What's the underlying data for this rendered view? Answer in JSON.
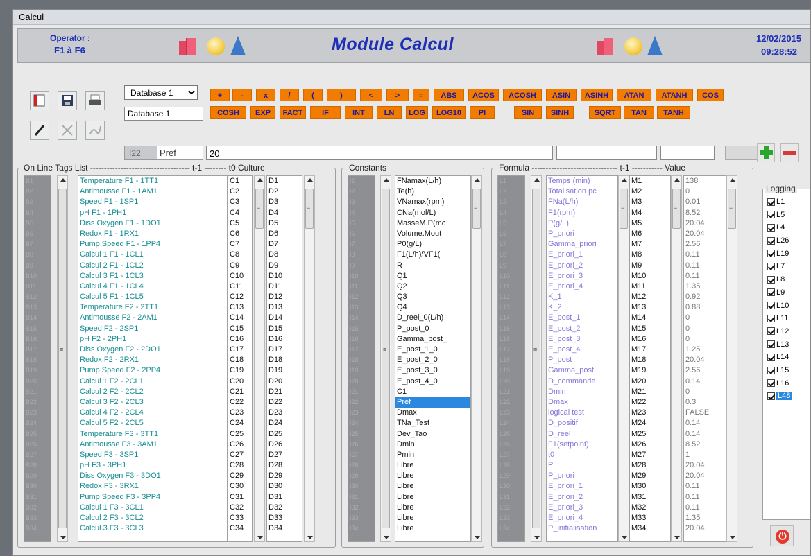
{
  "window": {
    "title": "Calcul"
  },
  "header": {
    "operator_label": "Operator :",
    "operator_value": "F1 à F6",
    "title": "Module Calcul",
    "date": "12/02/2015",
    "time": "09:28:52"
  },
  "toolbar": {
    "icons": [
      "folder-icon",
      "save-icon",
      "printer-icon",
      "pencil-icon",
      "cut-icon",
      "signature-icon"
    ],
    "db_select": "Database 1",
    "db_name": "Database 1",
    "cell_ref": "I22",
    "cell_name": "Pref",
    "formula_value": "20",
    "op_row1": [
      "+",
      "-",
      "x",
      "/",
      "(",
      ")",
      "<",
      ">",
      "=",
      "ABS",
      "ACOS",
      "ACOSH",
      "ASIN",
      "ASINH",
      "ATAN",
      "ATANH",
      "COS"
    ],
    "op_row2": [
      "COSH",
      "EXP",
      "FACT",
      "IF",
      "INT",
      "LN",
      "LOG",
      "LOG10",
      "PI",
      "SIN",
      "SINH",
      "SQRT",
      "TAN",
      "TANH"
    ]
  },
  "tags_group": {
    "label": "On Line Tags List ------------------------------------ t-1 -------- t0 Culture"
  },
  "constants_group": {
    "label": "Constants"
  },
  "formula_group": {
    "label": "Formula ------------------------------- t-1 ----------- Value"
  },
  "row_ids_b": [
    "B1",
    "B2",
    "B3",
    "B4",
    "B5",
    "B6",
    "B7",
    "B8",
    "B9",
    "B10",
    "B11",
    "B12",
    "B13",
    "B14",
    "B15",
    "B16",
    "B17",
    "B18",
    "B19",
    "B20",
    "B21",
    "B22",
    "B23",
    "B24",
    "B25",
    "B26",
    "B27",
    "B28",
    "B29",
    "B30",
    "B31",
    "B32",
    "B33",
    "B34"
  ],
  "row_ids_i": [
    "I1",
    "I2",
    "I3",
    "I4",
    "I5",
    "I6",
    "I7",
    "I8",
    "I9",
    "I10",
    "I11",
    "I12",
    "I13",
    "I14",
    "I15",
    "I16",
    "I17",
    "I18",
    "I19",
    "I20",
    "I21",
    "I22",
    "I23",
    "I24",
    "I25",
    "I26",
    "I27",
    "I28",
    "I29",
    "I30",
    "I31",
    "I32",
    "I33",
    "I34"
  ],
  "row_ids_l": [
    "L1",
    "L2",
    "L3",
    "L4",
    "L5",
    "L6",
    "L7",
    "L8",
    "L9",
    "L10",
    "L11",
    "L12",
    "L13",
    "L14",
    "L15",
    "L16",
    "L17",
    "L18",
    "L19",
    "L20",
    "L21",
    "L22",
    "L23",
    "L24",
    "L25",
    "L26",
    "L27",
    "L28",
    "L29",
    "L30",
    "L31",
    "L32",
    "L33",
    "L34"
  ],
  "tags": [
    "Temperature F1 - 1TT1",
    "Antimousse F1 - 1AM1",
    "Speed F1 - 1SP1",
    "pH F1 - 1PH1",
    "Diss Oxygen F1 - 1DO1",
    "Redox F1 - 1RX1",
    "Pump Speed F1 - 1PP4",
    "Calcul 1 F1 - 1CL1",
    "Calcul 2 F1 - 1CL2",
    "Calcul 3 F1 - 1CL3",
    "Calcul 4 F1 - 1CL4",
    "Calcul 5 F1 - 1CL5",
    "Temperature F2 - 2TT1",
    "Antimousse F2 - 2AM1",
    "Speed F2 - 2SP1",
    "pH F2 - 2PH1",
    "Diss Oxygen F2 - 2DO1",
    "Redox F2 - 2RX1",
    "Pump Speed F2 - 2PP4",
    "Calcul 1 F2 - 2CL1",
    "Calcul 2 F2 - 2CL2",
    "Calcul 3 F2 - 2CL3",
    "Calcul 4 F2 - 2CL4",
    "Calcul 5 F2 - 2CL5",
    "Temperature F3 - 3TT1",
    "Antimousse F3 - 3AM1",
    "Speed F3 - 3SP1",
    "pH F3 - 3PH1",
    "Diss Oxygen F3 - 3DO1",
    "Redox F3 - 3RX1",
    "Pump Speed F3 - 3PP4",
    "Calcul 1 F3 - 3CL1",
    "Calcul 2 F3 - 3CL2",
    "Calcul 3 F3 - 3CL3"
  ],
  "c_col": [
    "C1",
    "C2",
    "C3",
    "C4",
    "C5",
    "C6",
    "C7",
    "C8",
    "C9",
    "C10",
    "C11",
    "C12",
    "C13",
    "C14",
    "C15",
    "C16",
    "C17",
    "C18",
    "C19",
    "C20",
    "C21",
    "C22",
    "C23",
    "C24",
    "C25",
    "C26",
    "C27",
    "C28",
    "C29",
    "C30",
    "C31",
    "C32",
    "C33",
    "C34"
  ],
  "d_col": [
    "D1",
    "D2",
    "D3",
    "D4",
    "D5",
    "D6",
    "D7",
    "D8",
    "D9",
    "D10",
    "D11",
    "D12",
    "D13",
    "D14",
    "D15",
    "D16",
    "D17",
    "D18",
    "D19",
    "D20",
    "D21",
    "D22",
    "D23",
    "D24",
    "D25",
    "D26",
    "D27",
    "D28",
    "D29",
    "D30",
    "D31",
    "D32",
    "D33",
    "D34"
  ],
  "constants": [
    "FNamax(L/h)",
    "Te(h)",
    "VNamax(rpm)",
    "CNa(mol/L)",
    "MasseM.P(mc",
    "Volume.Mout",
    "P0(g/L)",
    "F1(L/h)/VF1(",
    "R",
    "Q1",
    "Q2",
    "Q3",
    "Q4",
    "D_reel_0(L/h)",
    "P_post_0",
    "Gamma_post_",
    "E_post_1_0",
    "E_post_2_0",
    "E_post_3_0",
    "E_post_4_0",
    "C1",
    "Pref",
    "Dmax",
    "TNa_Test",
    "Dev_Tao",
    "Dmin",
    "Pmin",
    "Libre",
    "Libre",
    "Libre",
    "Libre",
    "Libre",
    "Libre",
    "Libre"
  ],
  "formulas": [
    "Temps (min)",
    "Totalisation pc",
    "FNa(L/h)",
    "F1(rpm)",
    "P(g/L)",
    "P_priori",
    "Gamma_priori",
    "E_priori_1",
    "E_priori_2",
    "E_priori_3",
    "E_priori_4",
    "K_1",
    "K_2",
    "E_post_1",
    "E_post_2",
    "E_post_3",
    "E_post_4",
    "P_post",
    "Gamma_post",
    "D_commande",
    "Dmin",
    "Dmax",
    "logical test",
    "D_positif",
    "D_reel",
    "F1(setpoint)",
    "t0",
    "P",
    "P_priori",
    "E_priori_1",
    "E_priori_2",
    "E_priori_3",
    "E_priori_4",
    "P_initialisation"
  ],
  "m_col": [
    "M1",
    "M2",
    "M3",
    "M4",
    "M5",
    "M6",
    "M7",
    "M8",
    "M9",
    "M10",
    "M11",
    "M12",
    "M13",
    "M14",
    "M15",
    "M16",
    "M17",
    "M18",
    "M19",
    "M20",
    "M21",
    "M22",
    "M23",
    "M24",
    "M25",
    "M26",
    "M27",
    "M28",
    "M29",
    "M30",
    "M31",
    "M32",
    "M33",
    "M34"
  ],
  "values": [
    "138",
    "0",
    "0.01",
    "8.52",
    "20.04",
    "20.04",
    "2.56",
    "0.11",
    "0.11",
    "0.11",
    "1.35",
    "0.92",
    "0.88",
    "0",
    "0",
    "0",
    "1.25",
    "20.04",
    "2.56",
    "0.14",
    "0",
    "0.3",
    "FALSE",
    "0.14",
    "0.14",
    "8.52",
    "1",
    "20.04",
    "20.04",
    "0.11",
    "0.11",
    "0.11",
    "1.35",
    "20.04"
  ],
  "logging": {
    "label": "Logging",
    "items": [
      "L1",
      "L5",
      "L4",
      "L26",
      "L19",
      "L7",
      "L8",
      "L9",
      "L10",
      "L11",
      "L12",
      "L13",
      "L14",
      "L15",
      "L16",
      "L48"
    ]
  },
  "colors": {
    "orange_button": "#f27c00",
    "header_blue": "#1d2fb6",
    "tag_teal": "#168d92",
    "formula_lavender": "#8478d8",
    "selection": "#2a89df"
  }
}
